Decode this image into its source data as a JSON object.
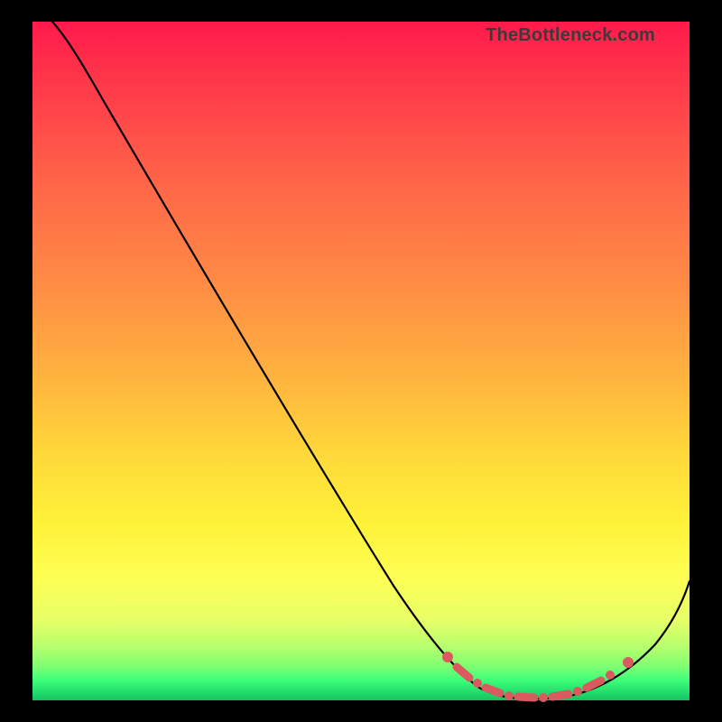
{
  "attribution": "TheBottleneck.com",
  "chart_data": {
    "type": "line",
    "title": "",
    "xlabel": "",
    "ylabel": "",
    "xlim": [
      0,
      100
    ],
    "ylim": [
      0,
      100
    ],
    "series": [
      {
        "name": "bottleneck-curve",
        "x": [
          0,
          4,
          10,
          20,
          30,
          40,
          50,
          60,
          66,
          70,
          74,
          78,
          82,
          86,
          90,
          94,
          100
        ],
        "y": [
          100,
          98,
          93,
          80,
          67,
          54,
          41,
          28,
          18,
          11,
          6,
          3,
          1,
          1,
          3,
          8,
          20
        ]
      }
    ],
    "highlight_range_x": [
      66,
      94
    ],
    "highlight_style": "salmon-dotted",
    "gradient_stops": [
      {
        "pos": 0,
        "color": "#ff1a4b"
      },
      {
        "pos": 50,
        "color": "#ffc23d"
      },
      {
        "pos": 80,
        "color": "#fff23a"
      },
      {
        "pos": 100,
        "color": "#19c05e"
      }
    ]
  }
}
